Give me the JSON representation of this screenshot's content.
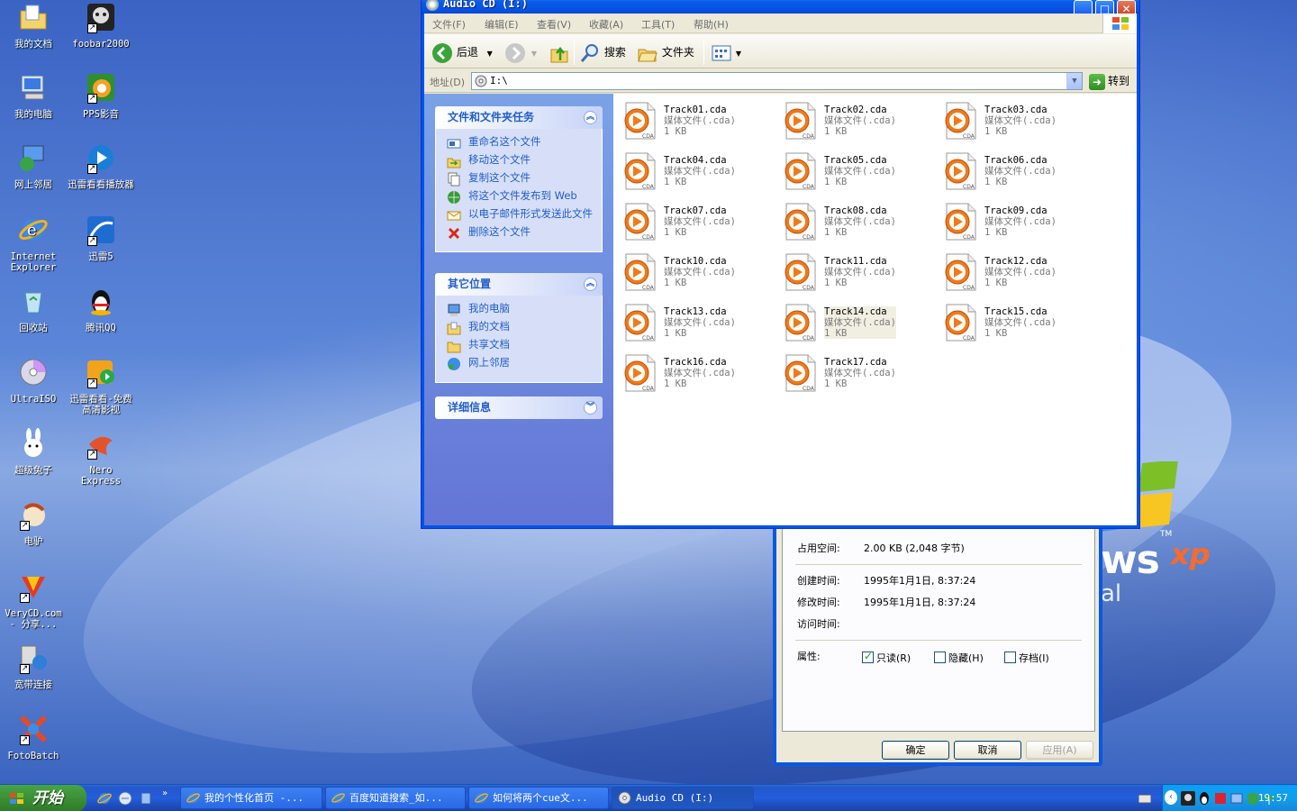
{
  "desktop": {
    "icons": [
      {
        "label": "我的文档"
      },
      {
        "label": "foobar2000"
      },
      {
        "label": "我的电脑"
      },
      {
        "label": "PPS影音"
      },
      {
        "label": "网上邻居"
      },
      {
        "label": "迅雷看看播放器"
      },
      {
        "label": "Internet Explorer"
      },
      {
        "label": "迅雷5"
      },
      {
        "label": "回收站"
      },
      {
        "label": "腾讯QQ"
      },
      {
        "label": "UltraISO"
      },
      {
        "label": "迅雷看看-免费高清影视"
      },
      {
        "label": "超级兔子"
      },
      {
        "label": "Nero Express"
      },
      {
        "label": "电驴"
      },
      {
        "label": "VeryCD.com - 分享..."
      },
      {
        "label": "宽带连接"
      },
      {
        "label": "FotoBatch"
      }
    ],
    "branding": {
      "logo_text": "ws",
      "logo_sup": "xp",
      "tm": "TM",
      "sub": "al"
    }
  },
  "explorer": {
    "title": "Audio CD (I:)",
    "menu": [
      "文件(F)",
      "编辑(E)",
      "查看(V)",
      "收藏(A)",
      "工具(T)",
      "帮助(H)"
    ],
    "toolbar": {
      "back": "后退",
      "search": "搜索",
      "folders": "文件夹"
    },
    "address": {
      "label": "地址(D)",
      "value": "I:\\",
      "go": "转到"
    },
    "panels": {
      "file_tasks": {
        "title": "文件和文件夹任务",
        "items": [
          "重命名这个文件",
          "移动这个文件",
          "复制这个文件",
          "将这个文件发布到 Web",
          "以电子邮件形式发送此文件",
          "删除这个文件"
        ]
      },
      "other_places": {
        "title": "其它位置",
        "items": [
          "我的电脑",
          "我的文档",
          "共享文档",
          "网上邻居"
        ]
      },
      "details": {
        "title": "详细信息"
      }
    },
    "files": [
      {
        "name": "Track01.cda",
        "type": "媒体文件(.cda)",
        "size": "1 KB"
      },
      {
        "name": "Track02.cda",
        "type": "媒体文件(.cda)",
        "size": "1 KB"
      },
      {
        "name": "Track03.cda",
        "type": "媒体文件(.cda)",
        "size": "1 KB"
      },
      {
        "name": "Track04.cda",
        "type": "媒体文件(.cda)",
        "size": "1 KB"
      },
      {
        "name": "Track05.cda",
        "type": "媒体文件(.cda)",
        "size": "1 KB"
      },
      {
        "name": "Track06.cda",
        "type": "媒体文件(.cda)",
        "size": "1 KB"
      },
      {
        "name": "Track07.cda",
        "type": "媒体文件(.cda)",
        "size": "1 KB"
      },
      {
        "name": "Track08.cda",
        "type": "媒体文件(.cda)",
        "size": "1 KB"
      },
      {
        "name": "Track09.cda",
        "type": "媒体文件(.cda)",
        "size": "1 KB"
      },
      {
        "name": "Track10.cda",
        "type": "媒体文件(.cda)",
        "size": "1 KB"
      },
      {
        "name": "Track11.cda",
        "type": "媒体文件(.cda)",
        "size": "1 KB"
      },
      {
        "name": "Track12.cda",
        "type": "媒体文件(.cda)",
        "size": "1 KB"
      },
      {
        "name": "Track13.cda",
        "type": "媒体文件(.cda)",
        "size": "1 KB"
      },
      {
        "name": "Track14.cda",
        "type": "媒体文件(.cda)",
        "size": "1 KB"
      },
      {
        "name": "Track15.cda",
        "type": "媒体文件(.cda)",
        "size": "1 KB"
      },
      {
        "name": "Track16.cda",
        "type": "媒体文件(.cda)",
        "size": "1 KB"
      },
      {
        "name": "Track17.cda",
        "type": "媒体文件(.cda)",
        "size": "1 KB"
      }
    ],
    "file_icon_label": "CDA"
  },
  "properties": {
    "disk_size_label": "占用空间:",
    "disk_size_value": "2.00 KB (2,048 字节)",
    "created_label": "创建时间:",
    "created_value": "1995年1月1日, 8:37:24",
    "modified_label": "修改时间:",
    "modified_value": "1995年1月1日, 8:37:24",
    "accessed_label": "访问时间:",
    "attrs_label": "属性:",
    "readonly": "只读(R)",
    "hidden": "隐藏(H)",
    "archive": "存档(I)",
    "ok": "确定",
    "cancel": "取消",
    "apply": "应用(A)"
  },
  "taskbar": {
    "start": "开始",
    "tasks": [
      "我的个性化首页 -...",
      "百度知道搜索_如...",
      "如何将两个cue文...",
      "Audio CD (I:)"
    ],
    "clock": "19:57"
  }
}
